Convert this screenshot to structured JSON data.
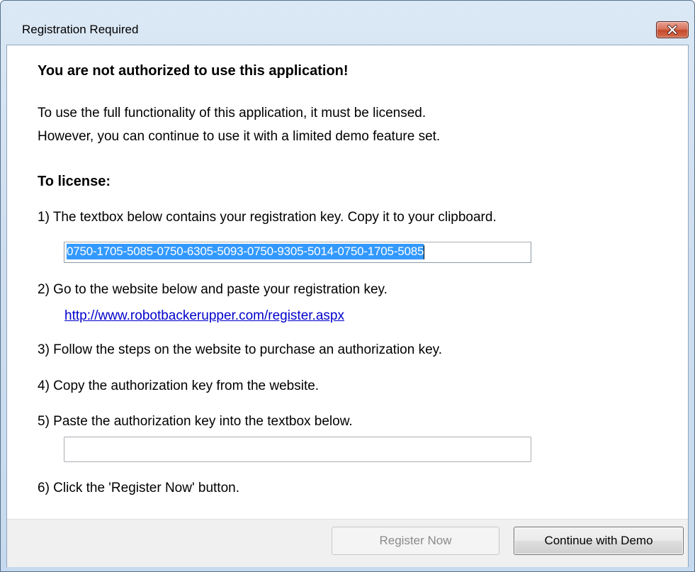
{
  "window": {
    "title": "Registration Required"
  },
  "content": {
    "heading": "You are not authorized to use this application!",
    "intro_line1": "To use the full functionality of this application, it must be licensed.",
    "intro_line2": "However, you can continue to use it with a limited demo feature set.",
    "subheading": "To license:",
    "steps": [
      "1) The textbox below contains your registration key. Copy it to your clipboard.",
      "2) Go to the website below and paste your registration key.",
      "3) Follow the steps on the website to purchase an authorization key.",
      "4) Copy the authorization key from the website.",
      "5) Paste the authorization key into the textbox below.",
      "6) Click the 'Register Now' button."
    ],
    "registration_key": "0750-1705-5085-0750-6305-5093-0750-9305-5014-0750-1705-5085",
    "register_url": "http://www.robotbackerupper.com/register.aspx",
    "authorization_key": ""
  },
  "buttons": {
    "register_now": "Register Now",
    "register_now_enabled": false,
    "continue_demo": "Continue with Demo"
  },
  "icons": {
    "close": "close-icon"
  },
  "colors": {
    "selection": "#3399ff",
    "link": "#0000cc",
    "close_button": "#c44a2c"
  }
}
